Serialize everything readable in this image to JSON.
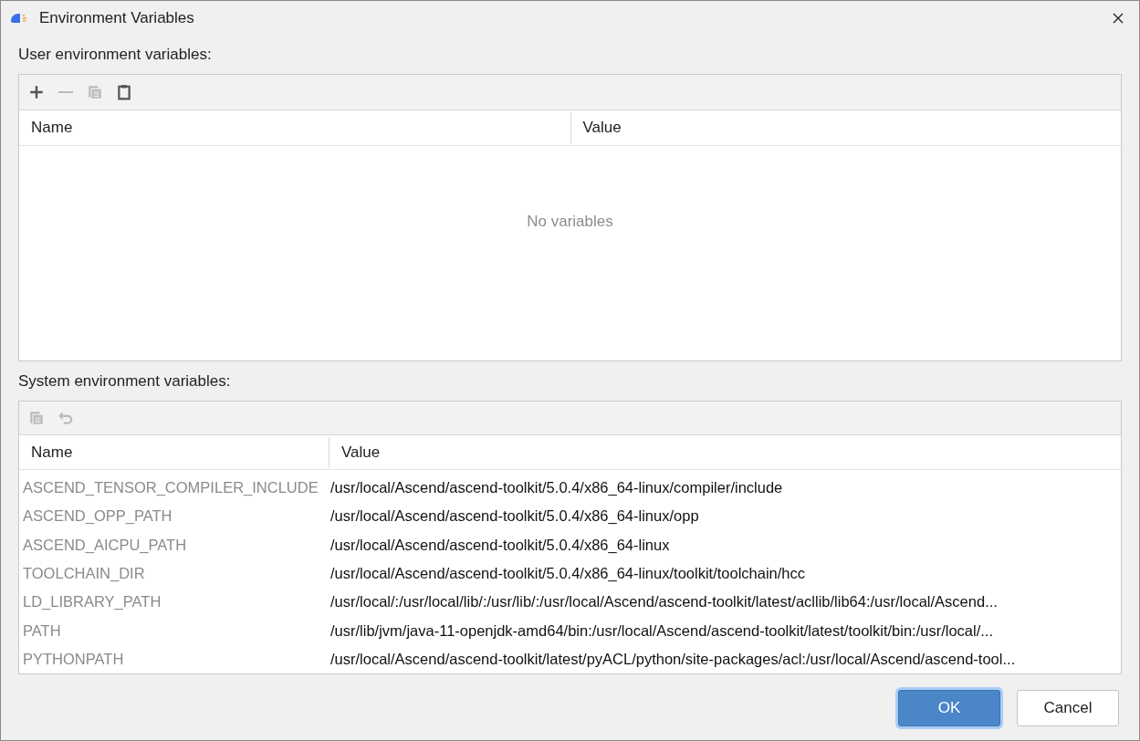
{
  "window": {
    "title": "Environment Variables"
  },
  "user_variables": {
    "label": "User environment variables:",
    "toolbar": [
      {
        "kind": "add",
        "disabled": false
      },
      {
        "kind": "remove",
        "disabled": true
      },
      {
        "kind": "copy",
        "disabled": true
      },
      {
        "kind": "paste",
        "disabled": false
      }
    ],
    "columns": [
      "Name",
      "Value"
    ],
    "empty_text": "No variables"
  },
  "system_variables": {
    "label": "System environment variables:",
    "toolbar": [
      {
        "kind": "copy",
        "disabled": true
      },
      {
        "kind": "undo",
        "disabled": true
      }
    ],
    "columns": [
      "Name",
      "Value"
    ],
    "rows": [
      {
        "name": "ASCEND_TENSOR_COMPILER_INCLUDE",
        "value": "/usr/local/Ascend/ascend-toolkit/5.0.4/x86_64-linux/compiler/include"
      },
      {
        "name": "ASCEND_OPP_PATH",
        "value": "/usr/local/Ascend/ascend-toolkit/5.0.4/x86_64-linux/opp"
      },
      {
        "name": "ASCEND_AICPU_PATH",
        "value": "/usr/local/Ascend/ascend-toolkit/5.0.4/x86_64-linux"
      },
      {
        "name": "TOOLCHAIN_DIR",
        "value": "/usr/local/Ascend/ascend-toolkit/5.0.4/x86_64-linux/toolkit/toolchain/hcc"
      },
      {
        "name": "LD_LIBRARY_PATH",
        "value": "/usr/local/:/usr/local/lib/:/usr/lib/:/usr/local/Ascend/ascend-toolkit/latest/acllib/lib64:/usr/local/Ascend..."
      },
      {
        "name": "PATH",
        "value": "/usr/lib/jvm/java-11-openjdk-amd64/bin:/usr/local/Ascend/ascend-toolkit/latest/toolkit/bin:/usr/local/..."
      },
      {
        "name": "PYTHONPATH",
        "value": "/usr/local/Ascend/ascend-toolkit/latest/pyACL/python/site-packages/acl:/usr/local/Ascend/ascend-tool..."
      }
    ]
  },
  "buttons": [
    {
      "label": "OK",
      "kind": "primary"
    },
    {
      "label": "Cancel",
      "kind": "secondary"
    }
  ]
}
